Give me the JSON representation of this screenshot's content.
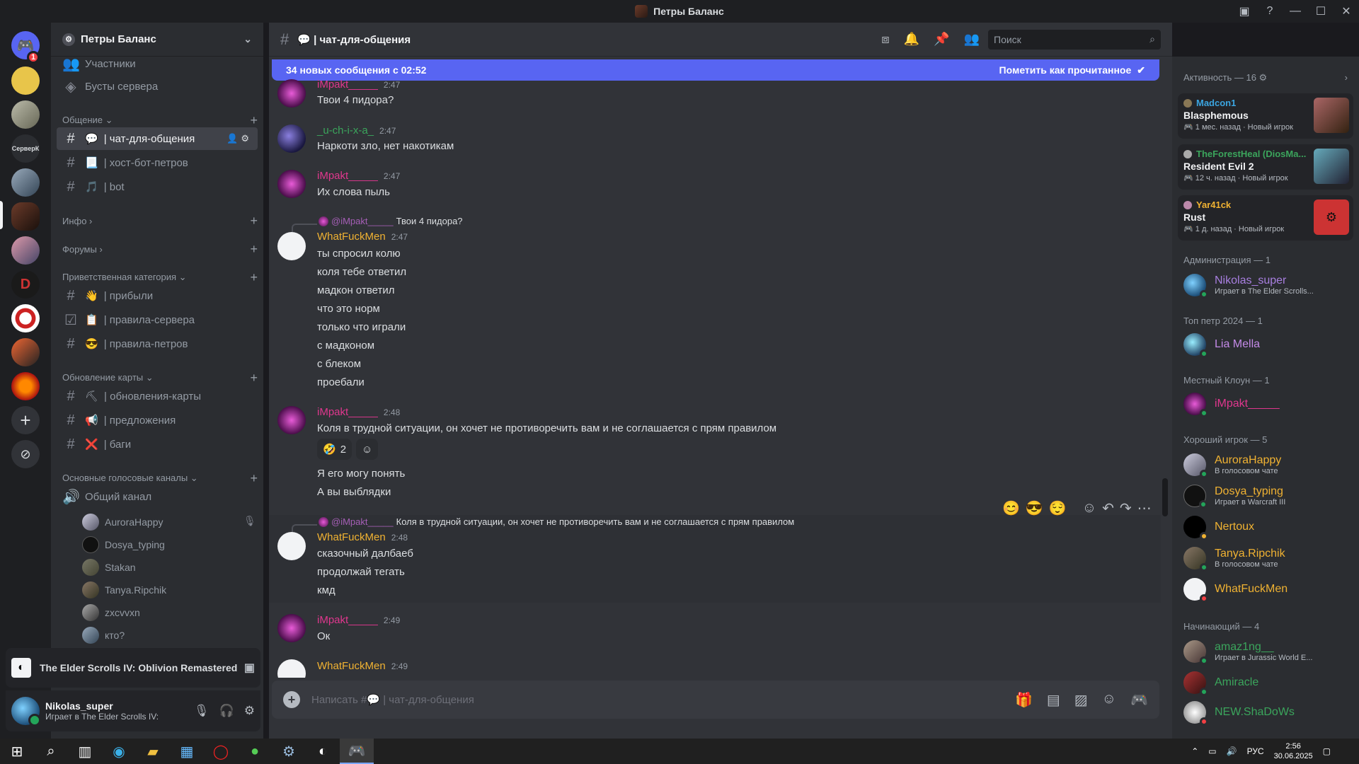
{
  "window": {
    "title": "Петры Баланс"
  },
  "server": {
    "name": "Петры Баланс",
    "items_top": [
      {
        "label": "Участники"
      },
      {
        "label": "Бусты сервера"
      }
    ],
    "rail_label": "СерверК",
    "rail_badge": "1"
  },
  "categories": [
    {
      "name": "Общение ⌄"
    },
    {
      "name": "Инфо ›"
    },
    {
      "name": "Форумы ›"
    },
    {
      "name": "Приветственная категория ⌄"
    },
    {
      "name": "Обновление карты ⌄"
    },
    {
      "name": "Основные голосовые каналы ⌄"
    }
  ],
  "channels": [
    {
      "label": "| чат-для-общения",
      "emoji": "💬"
    },
    {
      "label": "| хост-бот-петров",
      "emoji": "📃"
    },
    {
      "label": "| bot",
      "emoji": "🎵"
    },
    {
      "label": "| прибыли",
      "emoji": "👋"
    },
    {
      "label": "| правила-сервера",
      "emoji": "📋"
    },
    {
      "label": "| правила-петров",
      "emoji": "😎"
    },
    {
      "label": "| обновления-карты",
      "emoji": "⛏"
    },
    {
      "label": "| предложения",
      "emoji": "📢"
    },
    {
      "label": "| баги",
      "emoji": "❌"
    },
    {
      "label": "Общий канал"
    }
  ],
  "voice_users": [
    {
      "name": "AuroraHappy"
    },
    {
      "name": "Dosya_typing"
    },
    {
      "name": "Stakan"
    },
    {
      "name": "Tanya.Ripchik"
    },
    {
      "name": "zxcvvxn"
    },
    {
      "name": "кто?"
    }
  ],
  "activity_panel": {
    "game": "The Elder Scrolls IV: Oblivion Remastered"
  },
  "user_panel": {
    "name": "Nikolas_super",
    "status": "Играет в The Elder Scrolls IV:"
  },
  "chat_header": {
    "channel": "💬 | чат-для-общения",
    "search_placeholder": "Поиск"
  },
  "new_messages": {
    "text": "34 новых сообщения с 02:52",
    "mark_read": "Пометить как прочитанное"
  },
  "messages": [
    {
      "author": "iMpakt_____",
      "time": "2:47",
      "lines": [
        "Твои 4 пидора?"
      ]
    },
    {
      "author": "_u-ch-i-x-a_",
      "time": "2:47",
      "lines": [
        "Наркоти зло, нет накотикам"
      ]
    },
    {
      "author": "iMpakt_____",
      "time": "2:47",
      "lines": [
        "Их слова пыль"
      ]
    },
    {
      "reply_to": "@iMpakt_____",
      "reply_text": "Твои 4 пидора?",
      "author": "WhatFuckMen",
      "time": "2:47",
      "lines": [
        "ты спросил колю",
        "коля тебе ответил",
        "мадкон ответил",
        "что это норм",
        "только что играли",
        "с мадконом",
        "с блеком",
        "проебали"
      ]
    },
    {
      "author": "iMpakt_____",
      "time": "2:48",
      "lines": [
        "Коля в трудной ситуации, он хочет не противоречить вам и не соглашается с прям правилом",
        "Я его могу понять",
        "А вы выблядки"
      ],
      "reaction_count": "2"
    },
    {
      "reply_to": "@iMpakt_____",
      "reply_text": "Коля в трудной ситуации, он хочет не противоречить вам и не соглашается с прям правилом",
      "author": "WhatFuckMen",
      "time": "2:48",
      "lines": [
        "сказочный далбаеб",
        "продолжай тегать",
        "кмд"
      ]
    },
    {
      "author": "iMpakt_____",
      "time": "2:49",
      "lines": [
        "Ок"
      ]
    },
    {
      "author": "WhatFuckMen",
      "time": "2:49",
      "lines": []
    }
  ],
  "composer": {
    "placeholder": "Написать #💬 | чат-для-общения"
  },
  "members": {
    "activity_header": "Активность — 16 ⚙",
    "activity_cards": [
      {
        "user": "Madcon1",
        "game": "Blasphemous",
        "when": "1 мес. назад",
        "tag": "Новый игрок"
      },
      {
        "user": "TheForestHeal (DiosMa...",
        "game": "Resident Evil 2",
        "when": "12 ч. назад",
        "tag": "Новый игрок"
      },
      {
        "user": "Yar41ck",
        "game": "Rust",
        "when": "1 д. назад",
        "tag": "Новый игрок"
      }
    ],
    "groups": [
      {
        "name": "Администрация — 1",
        "users": [
          {
            "name": "Nikolas_super",
            "sub": "Играет в The Elder Scrolls..."
          }
        ]
      },
      {
        "name": "Топ петр 2024 — 1",
        "users": [
          {
            "name": "Lia Mella",
            "sub": ""
          }
        ]
      },
      {
        "name": "Местный Клоун — 1",
        "users": [
          {
            "name": "iMpakt_____",
            "sub": ""
          }
        ]
      },
      {
        "name": "Хороший игрок — 5",
        "users": [
          {
            "name": "AuroraHappy",
            "sub": "В голосовом чате"
          },
          {
            "name": "Dosya_typing",
            "sub": "Играет в Warcraft III"
          },
          {
            "name": "Nertoux",
            "sub": ""
          },
          {
            "name": "Tanya.Ripchik",
            "sub": "В голосовом чате"
          },
          {
            "name": "WhatFuckMen",
            "sub": ""
          }
        ]
      },
      {
        "name": "Начинающий — 4",
        "users": [
          {
            "name": "amaz1ng__",
            "sub": "Играет в Jurassic World E..."
          },
          {
            "name": "Amiracle",
            "sub": ""
          },
          {
            "name": "NEW.ShaDoWs",
            "sub": ""
          }
        ]
      }
    ]
  },
  "taskbar": {
    "lang": "РУС",
    "time": "2:56",
    "date": "30.06.2025"
  },
  "colors": {
    "accent": "#5865f2",
    "pink": "#e0378e",
    "green": "#3ba55c",
    "gold": "#f0b232",
    "online": "#23a55a",
    "dnd": "#f23f43"
  }
}
